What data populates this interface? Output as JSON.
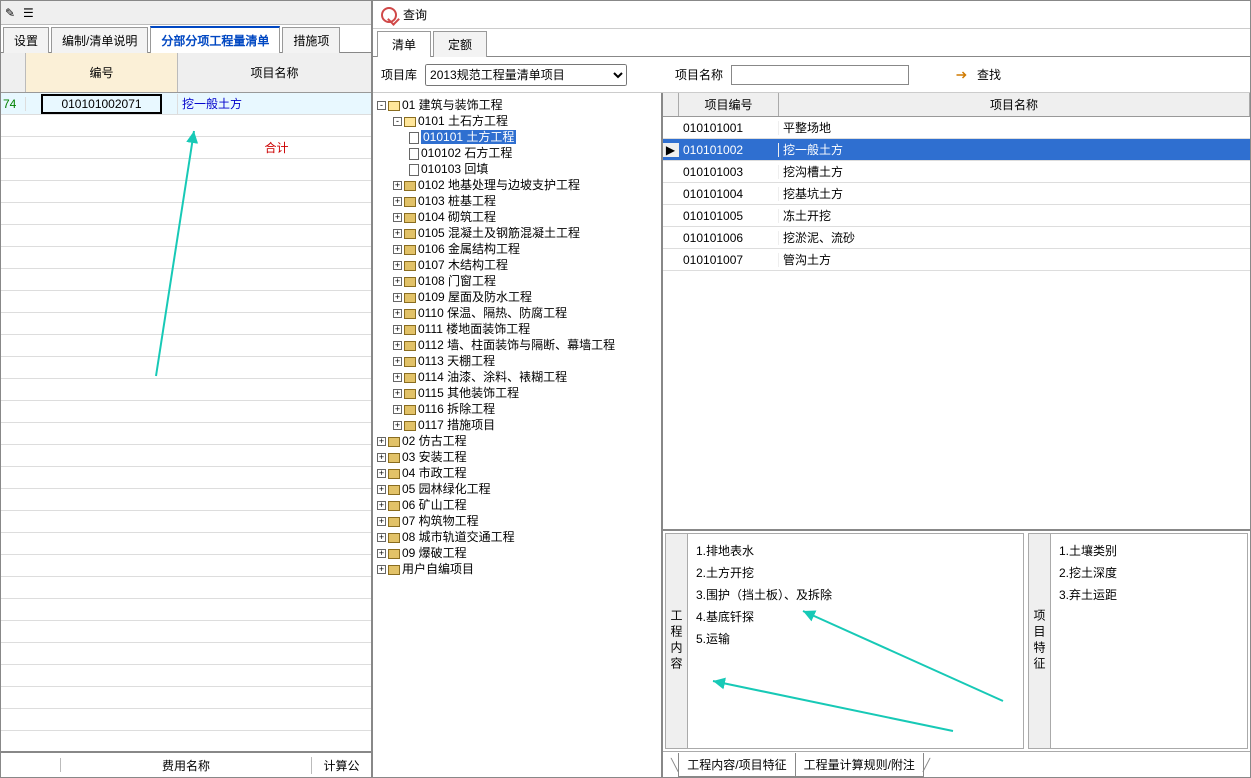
{
  "left": {
    "tabs": [
      "设置",
      "编制/清单说明",
      "分部分项工程量清单",
      "措施项"
    ],
    "active_tab_index": 2,
    "headers": {
      "code": "编号",
      "name": "项目名称"
    },
    "row_index": "74",
    "row_code": "010101002071",
    "row_name": "挖一般土方",
    "totals_label": "合计",
    "footer_label": "费用名称",
    "footer_calc": "计算公"
  },
  "window_title": "查询",
  "right_tabs": [
    "清单",
    "定额"
  ],
  "filter": {
    "lib_label": "项目库",
    "lib_value": "2013规范工程量清单项目",
    "name_label": "项目名称",
    "name_value": "",
    "find_label": "查找"
  },
  "tree": [
    {
      "exp": "-",
      "open": true,
      "label": "01 建筑与装饰工程",
      "children": [
        {
          "exp": "-",
          "open": true,
          "label": "0101 土石方工程",
          "children": [
            {
              "doc": true,
              "label": "010101 土方工程",
              "selected": true
            },
            {
              "doc": true,
              "label": "010102 石方工程"
            },
            {
              "doc": true,
              "label": "010103 回填"
            }
          ]
        },
        {
          "exp": "+",
          "label": "0102 地基处理与边坡支护工程"
        },
        {
          "exp": "+",
          "label": "0103 桩基工程"
        },
        {
          "exp": "+",
          "label": "0104 砌筑工程"
        },
        {
          "exp": "+",
          "label": "0105 混凝土及钢筋混凝土工程"
        },
        {
          "exp": "+",
          "label": "0106 金属结构工程"
        },
        {
          "exp": "+",
          "label": "0107 木结构工程"
        },
        {
          "exp": "+",
          "label": "0108 门窗工程"
        },
        {
          "exp": "+",
          "label": "0109 屋面及防水工程"
        },
        {
          "exp": "+",
          "label": "0110 保温、隔热、防腐工程"
        },
        {
          "exp": "+",
          "label": "0111 楼地面装饰工程"
        },
        {
          "exp": "+",
          "label": "0112 墙、柱面装饰与隔断、幕墙工程"
        },
        {
          "exp": "+",
          "label": "0113 天棚工程"
        },
        {
          "exp": "+",
          "label": "0114 油漆、涂料、裱糊工程"
        },
        {
          "exp": "+",
          "label": "0115 其他装饰工程"
        },
        {
          "exp": "+",
          "label": "0116 拆除工程"
        },
        {
          "exp": "+",
          "label": "0117 措施项目"
        }
      ]
    },
    {
      "exp": "+",
      "label": "02 仿古工程"
    },
    {
      "exp": "+",
      "label": "03 安装工程"
    },
    {
      "exp": "+",
      "label": "04 市政工程"
    },
    {
      "exp": "+",
      "label": "05 园林绿化工程"
    },
    {
      "exp": "+",
      "label": "06 矿山工程"
    },
    {
      "exp": "+",
      "label": "07 构筑物工程"
    },
    {
      "exp": "+",
      "label": "08 城市轨道交通工程"
    },
    {
      "exp": "+",
      "label": "09 爆破工程"
    },
    {
      "exp": "+",
      "label": "用户自编项目"
    }
  ],
  "grid2": {
    "headers": {
      "code": "项目编号",
      "name": "项目名称"
    },
    "rows": [
      {
        "code": "010101001",
        "name": "平整场地"
      },
      {
        "code": "010101002",
        "name": "挖一般土方",
        "selected": true
      },
      {
        "code": "010101003",
        "name": "挖沟槽土方"
      },
      {
        "code": "010101004",
        "name": "挖基坑土方"
      },
      {
        "code": "010101005",
        "name": "冻土开挖"
      },
      {
        "code": "010101006",
        "name": "挖淤泥、流砂"
      },
      {
        "code": "010101007",
        "name": "管沟土方"
      }
    ]
  },
  "detail": {
    "left_head": "工程内容",
    "left_items": [
      "1.排地表水",
      "2.土方开挖",
      "3.围护（挡土板）、及拆除",
      "4.基底钎探",
      "5.运输"
    ],
    "right_head": "项目特征",
    "right_items": [
      "1.土壤类别",
      "2.挖土深度",
      "3.弃土运距"
    ]
  },
  "bottom_tabs": [
    "工程内容/项目特征",
    "工程量计算规则/附注"
  ]
}
